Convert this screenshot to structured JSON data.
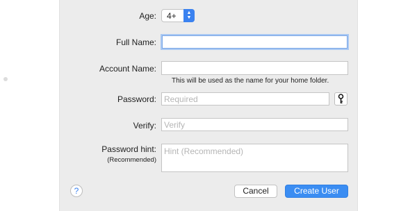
{
  "form": {
    "age": {
      "label": "Age:",
      "value": "4+"
    },
    "full_name": {
      "label": "Full Name:",
      "value": ""
    },
    "account_name": {
      "label": "Account Name:",
      "value": "",
      "helper": "This will be used as the name for your home folder."
    },
    "password": {
      "label": "Password:",
      "placeholder": "Required"
    },
    "verify": {
      "label": "Verify:",
      "placeholder": "Verify"
    },
    "hint": {
      "label": "Password hint:",
      "sub_label": "(Recommended)",
      "placeholder": "Hint (Recommended)"
    }
  },
  "buttons": {
    "help": "?",
    "cancel": "Cancel",
    "create": "Create User"
  },
  "icons": {
    "age_popup": "up-down-chevron-icon",
    "password_assistant": "key-icon",
    "help": "question-mark-icon"
  },
  "colors": {
    "accent": "#3b8df2",
    "sheet_background": "#ececec",
    "focus_ring": "#a9c8f3"
  }
}
